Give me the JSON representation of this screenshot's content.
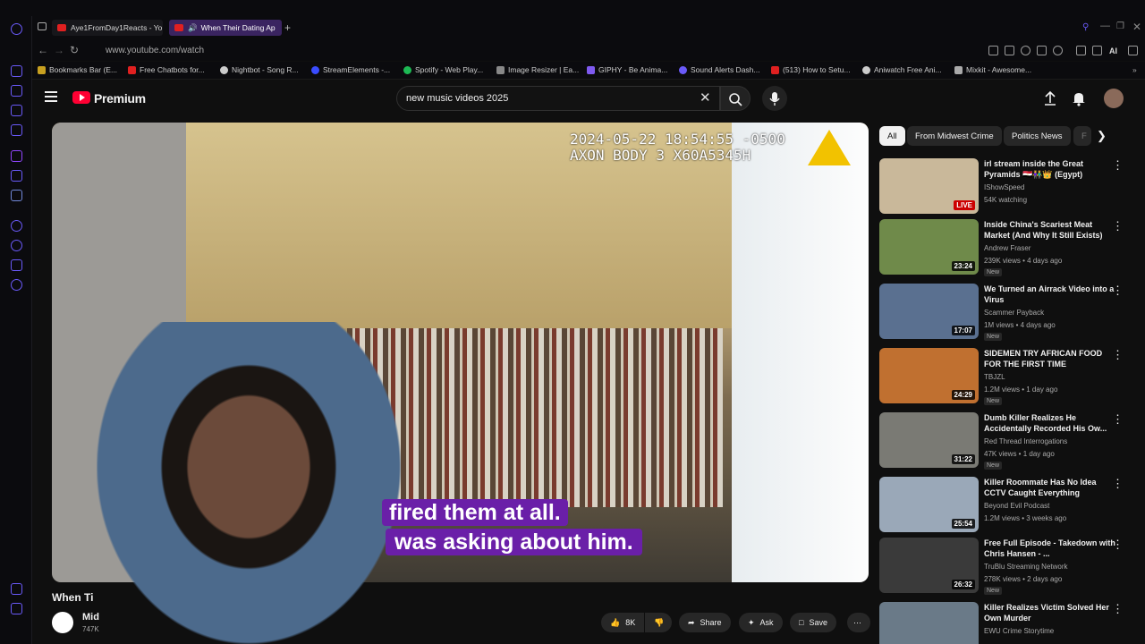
{
  "browser": {
    "tabs": [
      {
        "label": "Aye1FromDay1Reacts - Yo"
      },
      {
        "label": "When Their Dating Ap"
      }
    ],
    "new_tab_icon": "plus-icon",
    "url": "www.youtube.com/watch",
    "ai_label": "AI",
    "bookmarks": [
      {
        "label": "Bookmarks Bar (E...",
        "color": "#c8a020"
      },
      {
        "label": "Free Chatbots for...",
        "color": "#e02020"
      },
      {
        "label": "Nightbot - Song R...",
        "color": "#cccccc"
      },
      {
        "label": "StreamElements -...",
        "color": "#3a4cff"
      },
      {
        "label": "Spotify - Web Play...",
        "color": "#1db954"
      },
      {
        "label": "Image Resizer | Ea...",
        "color": "#888888"
      },
      {
        "label": "GIPHY - Be Anima...",
        "color": "#7f5af0"
      },
      {
        "label": "Sound Alerts Dash...",
        "color": "#6a5af9"
      },
      {
        "label": "(513) How to Setu...",
        "color": "#e02020"
      },
      {
        "label": "Aniwatch Free Ani...",
        "color": "#cccccc"
      },
      {
        "label": "Mixkit - Awesome...",
        "color": "#aaaaaa"
      }
    ]
  },
  "youtube": {
    "logo_label": "Premium",
    "search_value": "new music videos 2025",
    "colors": {
      "accent": "#ff0033",
      "caption_bg": "#6a1fa8"
    }
  },
  "video": {
    "timestamp_overlay": "2024-05-22 18:54:55 -0500\nAXON BODY 3 X60A5345H",
    "caption_line1": "fired them at all.",
    "caption_line2": "was asking about him.",
    "title_partial": "When Ti",
    "channel_partial": "Mid",
    "subs_partial": "747K",
    "actions": {
      "likes": "8K",
      "share": "Share",
      "ask": "Ask",
      "save": "Save"
    }
  },
  "chips": [
    "All",
    "From Midwest Crime",
    "Politics News",
    "F"
  ],
  "recommendations": [
    {
      "title": "irl stream inside the Great Pyramids 🇪🇬👫👑 (Egypt)",
      "channel": "IShowSpeed",
      "meta": "54K watching",
      "badge": "LIVE",
      "new": "",
      "thumb": "#c9b89a"
    },
    {
      "title": "Inside China's Scariest Meat Market (And Why It Still Exists)",
      "channel": "Andrew Fraser",
      "meta": "239K views • 4 days ago",
      "badge": "23:24",
      "new": "New",
      "thumb": "#6f8a4a"
    },
    {
      "title": "We Turned an Airrack Video into a Virus",
      "channel": "Scammer Payback",
      "meta": "1M views • 4 days ago",
      "badge": "17:07",
      "new": "New",
      "thumb": "#5a7090"
    },
    {
      "title": "SIDEMEN TRY AFRICAN FOOD FOR THE FIRST TIME",
      "channel": "TBJZL",
      "meta": "1.2M views • 1 day ago",
      "badge": "24:29",
      "new": "New",
      "thumb": "#c07030"
    },
    {
      "title": "Dumb Killer Realizes He Accidentally Recorded His Ow...",
      "channel": "Red Thread Interrogations",
      "meta": "47K views • 1 day ago",
      "badge": "31:22",
      "new": "New",
      "thumb": "#7a7a74"
    },
    {
      "title": "Killer Roommate Has No Idea CCTV Caught Everything",
      "channel": "Beyond Evil Podcast",
      "meta": "1.2M views • 3 weeks ago",
      "badge": "25:54",
      "new": "",
      "thumb": "#9aa8b8"
    },
    {
      "title": "Free Full Episode - Takedown with Chris Hansen - ...",
      "channel": "TruBlu Streaming Network",
      "meta": "278K views • 2 days ago",
      "badge": "26:32",
      "new": "New",
      "thumb": "#3a3a3a"
    },
    {
      "title": "Killer Realizes Victim Solved Her Own Murder",
      "channel": "EWU Crime Storytime",
      "meta": "",
      "badge": "",
      "new": "",
      "thumb": "#6a7a88"
    }
  ]
}
